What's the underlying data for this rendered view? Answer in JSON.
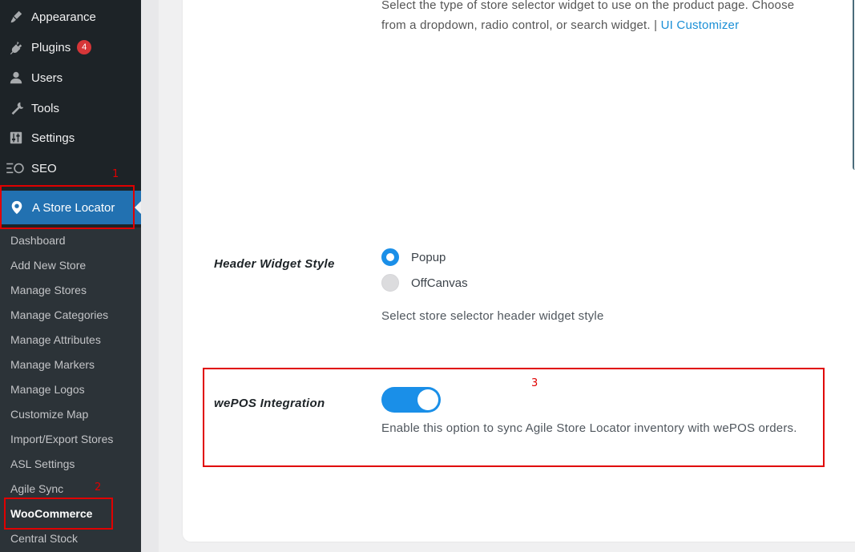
{
  "sidebar": {
    "menu": [
      {
        "label": "Appearance",
        "icon": "paintbrush-icon"
      },
      {
        "label": "Plugins",
        "icon": "plugin-icon",
        "badge": "4"
      },
      {
        "label": "Users",
        "icon": "users-icon"
      },
      {
        "label": "Tools",
        "icon": "wrench-icon"
      },
      {
        "label": "Settings",
        "icon": "settings-sliders-icon"
      },
      {
        "label": "SEO",
        "icon": "seo-icon"
      }
    ],
    "active": {
      "label": "A Store Locator",
      "icon": "map-pin-icon"
    },
    "submenu": [
      "Dashboard",
      "Add New Store",
      "Manage Stores",
      "Manage Categories",
      "Manage Attributes",
      "Manage Markers",
      "Manage Logos",
      "Customize Map",
      "Import/Export Stores",
      "ASL Settings",
      "Agile Sync",
      "WooCommerce",
      "Central Stock"
    ],
    "current_submenu": "WooCommerce"
  },
  "annotations": {
    "one": "1",
    "two": "2",
    "three": "3"
  },
  "main": {
    "top_desc_line1": "Select the type of store selector widget to use on the product page. Choose",
    "top_desc_line2": "from a dropdown, radio control, or search widget. |",
    "top_desc_link": "UI Customizer",
    "header_widget": {
      "label": "Header Widget Style",
      "options": [
        {
          "label": "Popup",
          "selected": true
        },
        {
          "label": "OffCanvas",
          "selected": false
        }
      ],
      "help": "Select store selector header widget style"
    },
    "wepos": {
      "label": "wePOS Integration",
      "enabled": true,
      "help": "Enable this option to sync Agile Store Locator inventory with wePOS orders."
    }
  },
  "colors": {
    "accent": "#2271b1",
    "toggle": "#1a8fe8",
    "annotation": "#e00000",
    "link": "#1a8fd6"
  }
}
